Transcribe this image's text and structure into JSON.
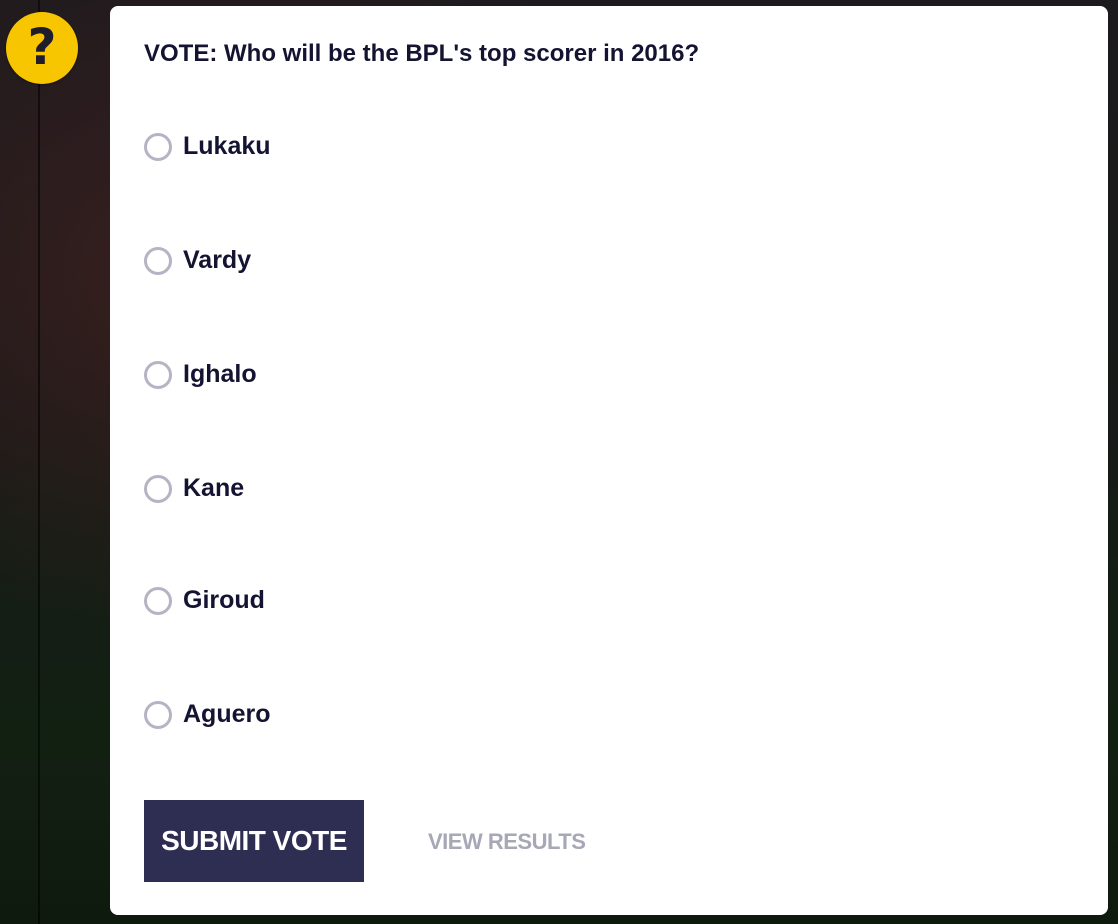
{
  "help": {
    "glyph": "?",
    "icon": "question-icon",
    "color": "#f7c600"
  },
  "poll": {
    "question": "VOTE: Who will be the BPL's top scorer in 2016?",
    "options": [
      {
        "label": "Lukaku"
      },
      {
        "label": "Vardy"
      },
      {
        "label": "Ighalo"
      },
      {
        "label": "Kane"
      },
      {
        "label": "Giroud"
      },
      {
        "label": "Aguero"
      }
    ],
    "submit_label": "SUBMIT VOTE",
    "results_label": "VIEW RESULTS"
  },
  "colors": {
    "button_bg": "#2e2d52",
    "text": "#141432",
    "muted": "#a7a7b6",
    "radio_border": "#b4b4c4"
  }
}
